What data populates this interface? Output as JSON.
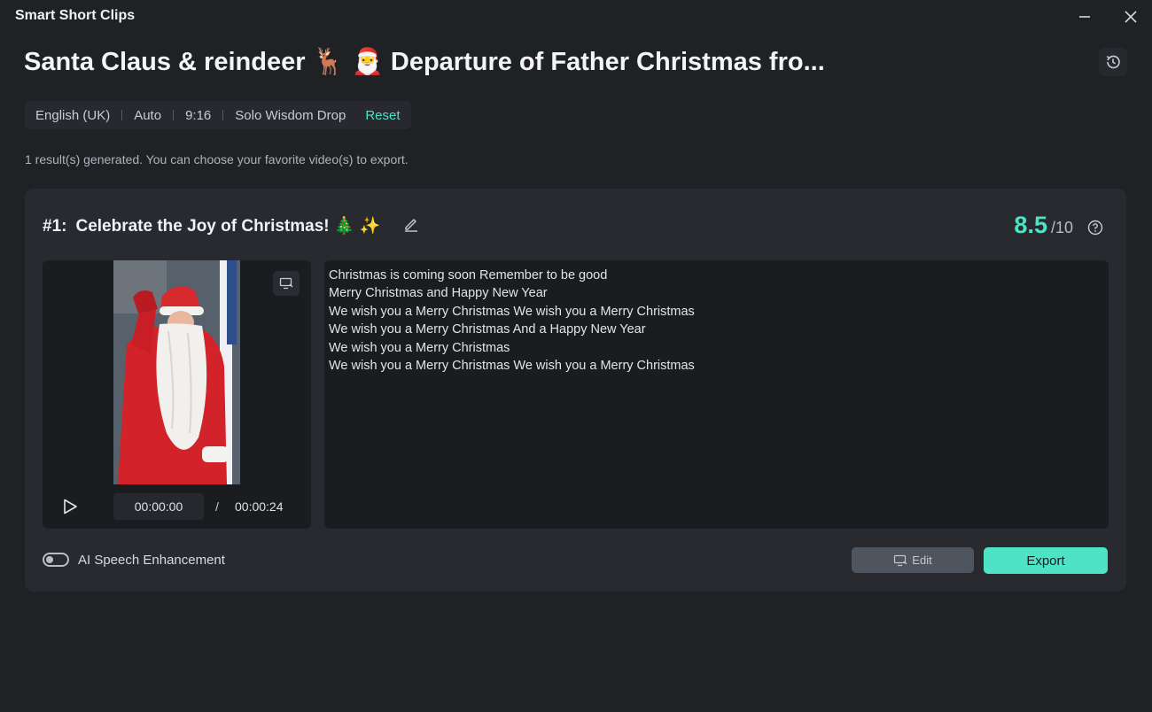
{
  "app": {
    "title": "Smart Short Clips"
  },
  "header": {
    "video_title": "Santa Claus & reindeer 🦌 🎅 Departure of Father Christmas fro..."
  },
  "settings": {
    "language": "English (UK)",
    "duration": "Auto",
    "aspect_ratio": "9:16",
    "template": "Solo Wisdom Drop",
    "reset_label": "Reset"
  },
  "results_note": "1 result(s) generated. You can choose your favorite video(s) to export.",
  "clip": {
    "index_label": "#1:",
    "title": "Celebrate the Joy of Christmas! 🎄 ✨",
    "score": "8.5",
    "score_max": "/10",
    "time_current": "00:00:00",
    "time_separator": "/",
    "time_total": "00:00:24",
    "transcript": [
      "Christmas is coming soon Remember to be good",
      "Merry Christmas and Happy New Year",
      "We wish you a Merry Christmas We wish you a Merry Christmas",
      "We wish you a Merry Christmas And a Happy New Year",
      "We wish you a Merry Christmas",
      "We wish you a Merry Christmas We wish you a Merry Christmas"
    ]
  },
  "footer": {
    "ai_speech_label": "AI Speech Enhancement",
    "ai_speech_enabled": false,
    "edit_label": "Edit",
    "export_label": "Export"
  },
  "colors": {
    "accent": "#4de3c4",
    "background": "#1f2125",
    "card": "#282a30"
  }
}
